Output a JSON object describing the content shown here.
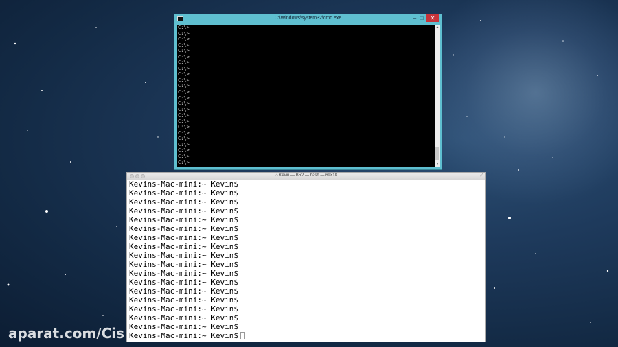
{
  "cmd_window": {
    "title": "C:\\Windows\\system32\\cmd.exe",
    "minimize_glyph": "–",
    "maximize_glyph": "□",
    "close_glyph": "✕",
    "prompt": "C:\\>",
    "prompt_count": 24,
    "scroll_up_glyph": "▲",
    "scroll_down_glyph": "▼"
  },
  "mac_terminal": {
    "title": "Kevin — BR2 — bash — 69×18",
    "home_glyph": "⌂",
    "resize_glyph": "⤢",
    "prompt": "Kevins-Mac-mini:~ Kevin$",
    "prompt_count": 18
  },
  "watermark": "aparat.com/Cis",
  "colors": {
    "cmd_frame": "#5fbfd0",
    "cmd_close": "#c7343a",
    "desktop": "#1e3a5c"
  }
}
